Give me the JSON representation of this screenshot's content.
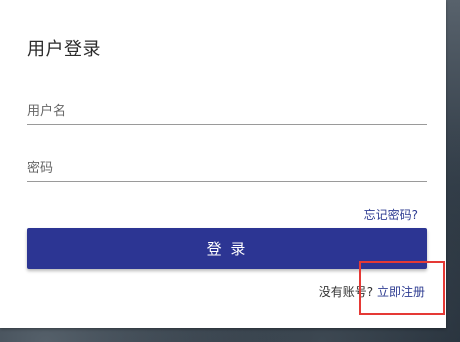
{
  "login": {
    "title": "用户登录",
    "username_placeholder": "用户名",
    "password_placeholder": "密码",
    "forgot_password": "忘记密码?",
    "login_button": "登 录",
    "no_account": "没有账号?",
    "register_link": "立即注册"
  },
  "colors": {
    "primary": "#2c3593",
    "link": "#2f3d92",
    "highlight": "#e53935"
  }
}
